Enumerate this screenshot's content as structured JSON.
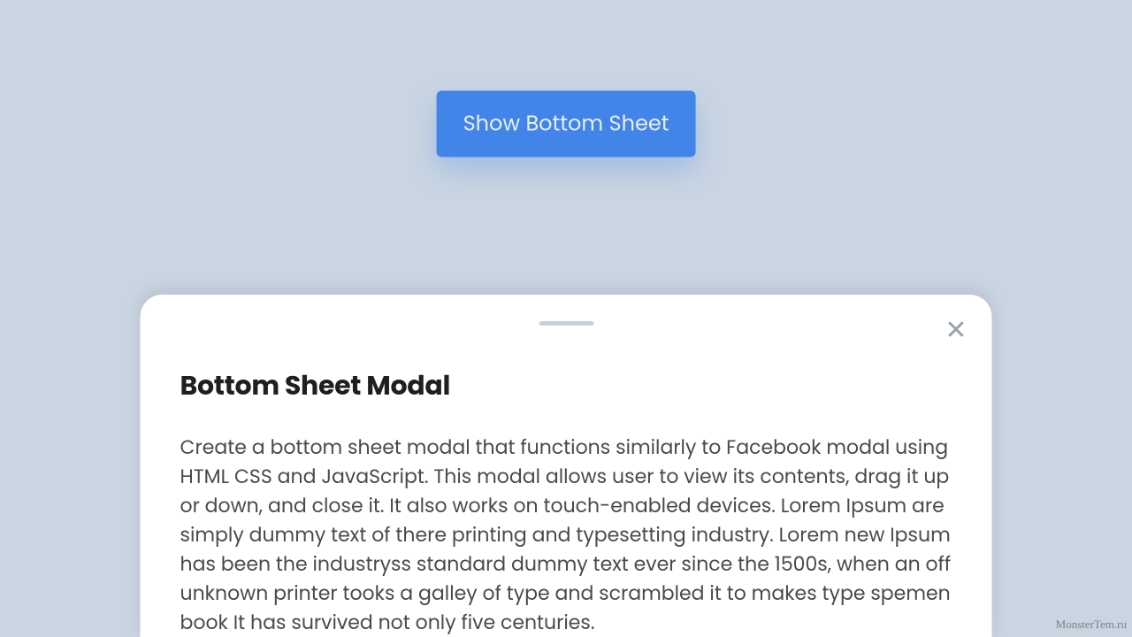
{
  "trigger": {
    "label": "Show Bottom Sheet"
  },
  "sheet": {
    "title": "Bottom Sheet Modal",
    "body": "Create a bottom sheet modal that functions similarly to Facebook modal using HTML CSS and JavaScript. This modal allows user to view its contents, drag it up or down, and close it. It also works on touch-enabled devices. Lorem Ipsum are simply dummy text of there printing and typesetting industry. Lorem new Ipsum has been the industryss standard dummy text ever since the 1500s, when an off unknown printer tooks a galley of type and scrambled it to makes type spemen book It has survived not only five centuries.",
    "close_glyph": "✕"
  },
  "watermark": "MonsterTem.ru",
  "colors": {
    "page_bg": "#cad5e2",
    "primary": "#4285e8",
    "handle": "#c7d0e1"
  }
}
